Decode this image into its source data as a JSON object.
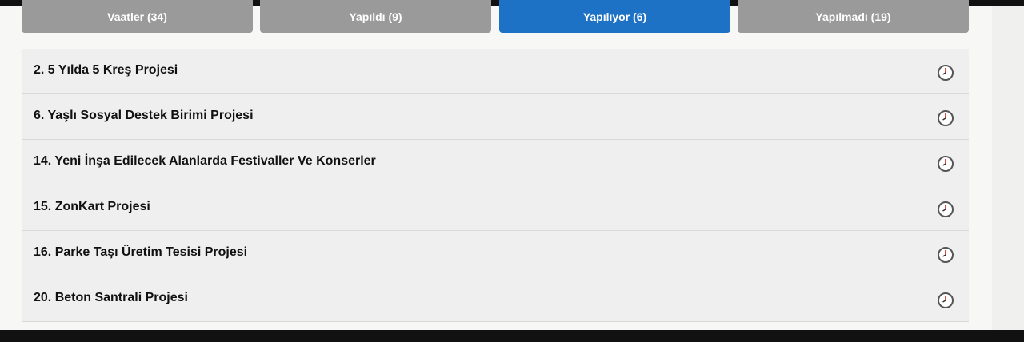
{
  "tabs": [
    {
      "label": "Vaatler (34)",
      "active": false
    },
    {
      "label": "Yapıldı (9)",
      "active": false
    },
    {
      "label": "Yapılıyor (6)",
      "active": true
    },
    {
      "label": "Yapılmadı (19)",
      "active": false
    }
  ],
  "items": [
    {
      "title": "2. 5 Yılda 5 Kreş Projesi",
      "status_icon": "clock-icon"
    },
    {
      "title": "6. Yaşlı Sosyal Destek Birimi Projesi",
      "status_icon": "clock-icon"
    },
    {
      "title": "14. Yeni İnşa Edilecek Alanlarda Festivaller Ve Konserler",
      "status_icon": "clock-icon"
    },
    {
      "title": "15. ZonKart Projesi",
      "status_icon": "clock-icon"
    },
    {
      "title": "16. Parke Taşı Üretim Tesisi Projesi",
      "status_icon": "clock-icon"
    },
    {
      "title": "20. Beton Santrali Projesi",
      "status_icon": "clock-icon"
    }
  ],
  "colors": {
    "tab_inactive": "#9a9a9a",
    "tab_active": "#1e72c5",
    "row_background": "#efefef",
    "clock_accent": "#d23a2a"
  }
}
